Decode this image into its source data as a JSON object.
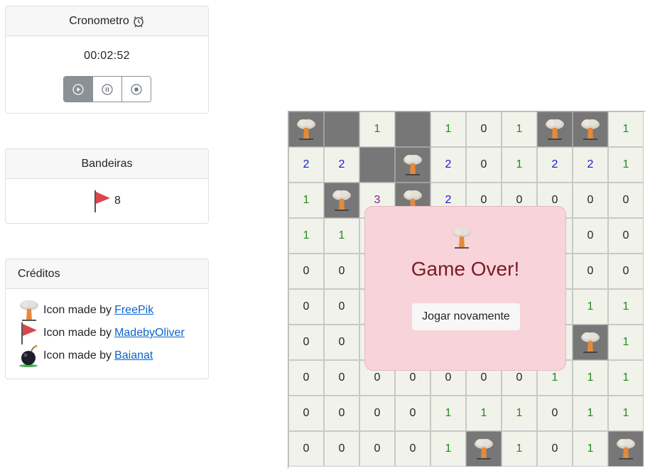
{
  "timer": {
    "title": "Cronometro",
    "title_icon": "alarm-clock-icon",
    "value": "00:02:52",
    "buttons": [
      "play-icon",
      "pause-icon",
      "stop-icon"
    ]
  },
  "flags": {
    "title": "Bandeiras",
    "count": "8"
  },
  "credits": {
    "title": "Créditos",
    "items": [
      {
        "icon": "explosion-icon",
        "text": "Icon made by",
        "link": "FreePik"
      },
      {
        "icon": "flag-icon",
        "text": "Icon made by",
        "link": "MadebyOliver"
      },
      {
        "icon": "bomb-icon",
        "text": "Icon made by",
        "link": "Baianat"
      }
    ]
  },
  "board": {
    "rows": [
      [
        "M",
        "H",
        "1",
        "H",
        "1",
        "0",
        "1",
        "M",
        "M",
        "1"
      ],
      [
        "2",
        "2",
        "H",
        "M",
        "2",
        "0",
        "1",
        "2",
        "2",
        "1"
      ],
      [
        "1",
        "M",
        "3",
        "M",
        "2",
        "0",
        "0",
        "0",
        "0",
        "0"
      ],
      [
        "1",
        "1",
        "",
        "",
        "",
        "",
        "",
        "",
        "0",
        "0"
      ],
      [
        "0",
        "0",
        "",
        "",
        "",
        "",
        "",
        "",
        "0",
        "0"
      ],
      [
        "0",
        "0",
        "",
        "",
        "",
        "",
        "",
        "",
        "1",
        "1"
      ],
      [
        "0",
        "0",
        "",
        "",
        "",
        "",
        "",
        "",
        "M",
        "1"
      ],
      [
        "0",
        "0",
        "0",
        "0",
        "0",
        "0",
        "0",
        "1",
        "1",
        "1"
      ],
      [
        "0",
        "0",
        "0",
        "0",
        "1",
        "1",
        "1",
        "0",
        "1",
        "1"
      ],
      [
        "0",
        "0",
        "0",
        "0",
        "1",
        "M",
        "1",
        "0",
        "1",
        "M"
      ]
    ]
  },
  "modal": {
    "icon": "explosion-icon",
    "title": "Game Over!",
    "button": "Jogar novamente"
  },
  "colors": {
    "hidden_cell": "#777777",
    "open_cell": "#f1f2ea",
    "modal_bg": "#f8d4da",
    "modal_title": "#7a1c22",
    "num1": "#1f8b1f",
    "num2": "#1a1ad8",
    "num3": "#8a1f8a"
  }
}
